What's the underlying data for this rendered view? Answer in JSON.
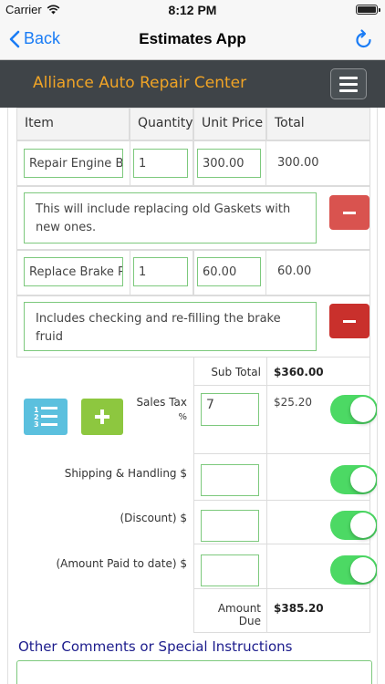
{
  "status_bar": {
    "carrier": "Carrier",
    "time": "8:12 PM"
  },
  "nav": {
    "back_label": "Back",
    "title": "Estimates App"
  },
  "header": {
    "brand": "Alliance Auto Repair Center"
  },
  "table": {
    "headers": [
      "Item",
      "Quantity",
      "Unit Price",
      "Total"
    ],
    "rows": [
      {
        "item": "Repair Engine Bloc",
        "quantity": "1",
        "unit_price": "300.00",
        "total": "300.00",
        "description": "This will include replacing old Gaskets with new ones."
      },
      {
        "item": "Replace Brake Pac",
        "quantity": "1",
        "unit_price": "60.00",
        "total": "60.00",
        "description": "Includes checking and re-filling the brake fruid"
      }
    ]
  },
  "summary": {
    "subtotal_label": "Sub Total",
    "subtotal_value": "$360.00",
    "sales_tax_label": "Sales Tax",
    "sales_tax_unit": "%",
    "sales_tax_input": "7",
    "sales_tax_value": "$25.20",
    "shipping_label": "Shipping & Handling $",
    "discount_label": "(Discount) $",
    "amount_paid_label": "(Amount Paid to date) $",
    "amount_due_label": "Amount Due",
    "amount_due_value": "$385.20"
  },
  "comments": {
    "title": "Other Comments or Special Instructions"
  },
  "colors": {
    "accent_blue": "#1a7cf5",
    "brand_orange": "#f0a426",
    "header_bg": "#3f4448",
    "toggle_green": "#4cd964",
    "delete_red": "#d9534f",
    "input_border": "#7dc97d"
  }
}
